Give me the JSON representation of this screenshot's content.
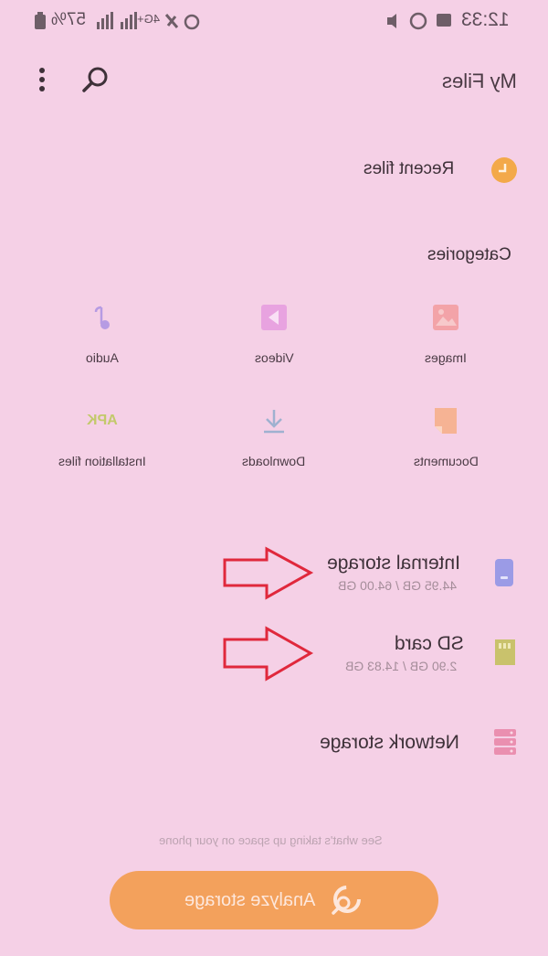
{
  "status_bar": {
    "time": "12:33",
    "battery": "57%",
    "network_type": "4G+"
  },
  "header": {
    "title": "My Files"
  },
  "recent": {
    "label": "Recent files"
  },
  "categories": {
    "heading": "Categories",
    "items": [
      {
        "label": "Images",
        "icon": "image-icon"
      },
      {
        "label": "Videos",
        "icon": "video-icon"
      },
      {
        "label": "Audio",
        "icon": "audio-icon"
      },
      {
        "label": "Documents",
        "icon": "document-icon"
      },
      {
        "label": "Downloads",
        "icon": "download-icon"
      },
      {
        "label": "Installation files",
        "icon": "apk-icon",
        "icon_text": "APK"
      }
    ]
  },
  "storage": {
    "items": [
      {
        "name": "Internal storage",
        "usage": "44.95 GB / 64.00 GB",
        "icon": "phone-storage-icon"
      },
      {
        "name": "SD card",
        "usage": "2.90 GB / 14.83 GB",
        "icon": "sd-card-icon"
      },
      {
        "name": "Network storage",
        "icon": "network-storage-icon"
      }
    ]
  },
  "footer": {
    "hint": "See what's taking up space on your phone",
    "analyze_label": "Analyze storage"
  },
  "colors": {
    "background": "#f5d0e6",
    "accent": "#f3a15c",
    "arrow": "#e0283c"
  }
}
